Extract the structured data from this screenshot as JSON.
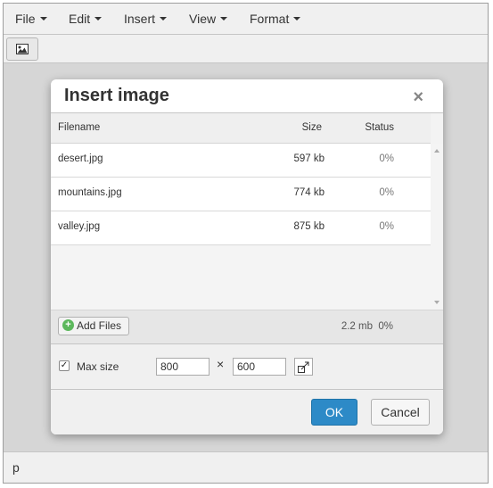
{
  "menu": {
    "file": "File",
    "edit": "Edit",
    "insert": "Insert",
    "view": "View",
    "format": "Format"
  },
  "toolbar": {
    "image_icon": "image-icon"
  },
  "dialog": {
    "title": "Insert image",
    "close": "×",
    "columns": {
      "filename": "Filename",
      "size": "Size",
      "status": "Status"
    },
    "files": [
      {
        "name": "desert.jpg",
        "size": "597 kb",
        "status": "0%"
      },
      {
        "name": "mountains.jpg",
        "size": "774 kb",
        "status": "0%"
      },
      {
        "name": "valley.jpg",
        "size": "875 kb",
        "status": "0%"
      }
    ],
    "add_files": "Add Files",
    "total_size": "2.2 mb",
    "total_status": "0%",
    "max_size_label": "Max size",
    "max_size_checked": true,
    "width": "800",
    "height": "600",
    "times": "×",
    "ok": "OK",
    "cancel": "Cancel"
  },
  "statusbar": {
    "path": "p"
  },
  "colors": {
    "accent": "#2d8ac7"
  }
}
